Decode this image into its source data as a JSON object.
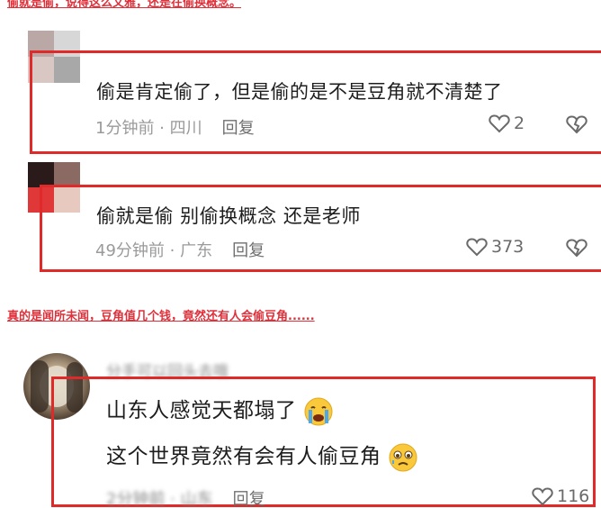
{
  "captions": {
    "top": "偷就是偷，说得这么文雅，还是在偷换概念。",
    "middle": "真的是闻所未闻，豆角值几个钱，竟然还有人会偷豆角......"
  },
  "comments": [
    {
      "text": "偷是肯定偷了，但是偷的是不是豆角就不清楚了",
      "time": "1分钟前",
      "location": "四川",
      "reply_label": "回复",
      "likes": "2"
    },
    {
      "text": "偷就是偷 别偷换概念 还是老师",
      "time": "49分钟前",
      "location": "广东",
      "reply_label": "回复",
      "likes": "373"
    },
    {
      "username": "分手可以回头去哦",
      "line1": "山东人感觉天都塌了",
      "line2": "这个世界竟然有会有人偷豆角",
      "time": "2分钟前",
      "location": "山东",
      "reply_label": "回复",
      "likes": "116"
    }
  ],
  "colors": {
    "highlight": "#e02a2a",
    "caption": "#e0303a",
    "meta": "#9a9a9a"
  },
  "icons": {
    "like": "heart-outline-icon",
    "dislike": "broken-heart-icon",
    "emoji1": "crying-face-emoji",
    "emoji2": "pleading-face-emoji"
  }
}
